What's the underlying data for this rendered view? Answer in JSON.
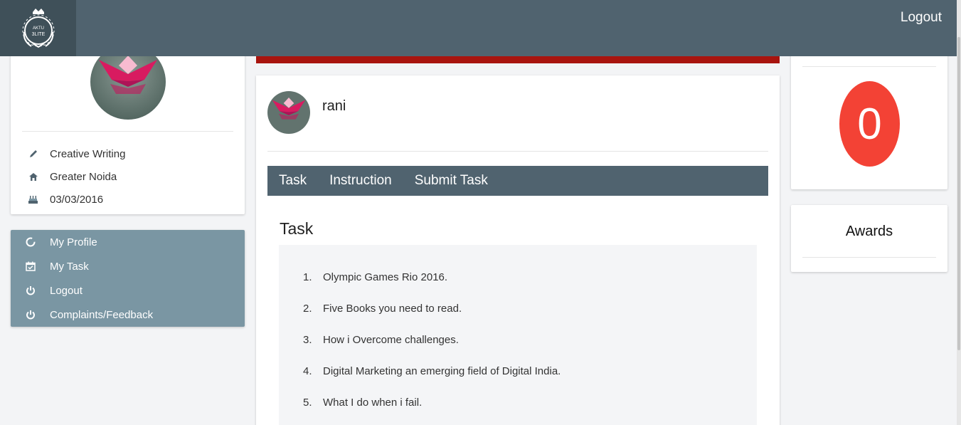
{
  "header": {
    "logo_text_top": "AKTU",
    "logo_text_bottom": "3LITE",
    "logout_label": "Logout"
  },
  "profile": {
    "interest": "Creative Writing",
    "city": "Greater Noida",
    "date": "03/03/2016"
  },
  "nav": {
    "items": [
      {
        "label": "My Profile",
        "icon": "circle-icon"
      },
      {
        "label": "My Task",
        "icon": "calendar-check-icon"
      },
      {
        "label": "Logout",
        "icon": "power-icon"
      },
      {
        "label": "Complaints/Feedback",
        "icon": "power-icon"
      }
    ]
  },
  "main": {
    "username": "rani",
    "tabs": [
      "Task",
      "Instruction",
      "Submit Task"
    ],
    "task_heading": "Task",
    "tasks": [
      {
        "num": "1.",
        "text": "Olympic Games Rio 2016."
      },
      {
        "num": "2.",
        "text": "Five Books you need to read."
      },
      {
        "num": "3.",
        "text": "How i Overcome challenges."
      },
      {
        "num": "4.",
        "text": "Digital Marketing an emerging field of Digital India."
      },
      {
        "num": "5.",
        "text": "What I do when i fail."
      }
    ]
  },
  "score": {
    "value": "0"
  },
  "awards": {
    "title": "Awards"
  },
  "colors": {
    "topbar": "#50636f",
    "accent_red": "#a8140e",
    "score": "#f34235",
    "nav": "#7a96a3"
  }
}
